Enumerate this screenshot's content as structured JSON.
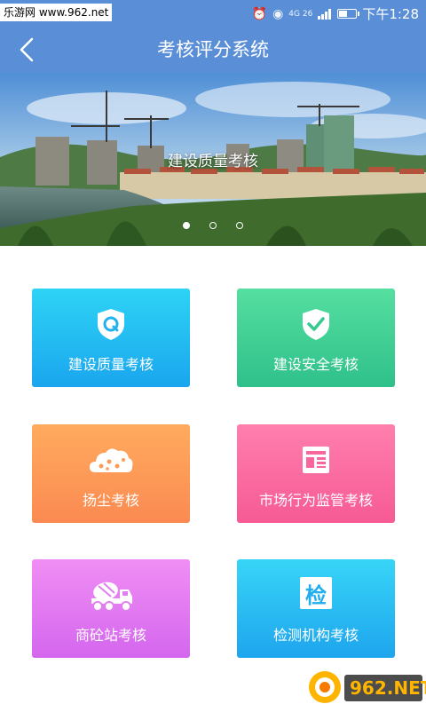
{
  "status_bar": {
    "watermark": "乐游网 www.962.net",
    "network": "4G 26",
    "battery_level": 0.5,
    "time": "下午1:28"
  },
  "nav": {
    "title": "考核评分系统",
    "back_icon": "chevron-left-icon"
  },
  "banner": {
    "caption": "建设质量考核",
    "slide_count": 3,
    "active_slide": 1
  },
  "tiles": [
    {
      "label": "建设质量考核",
      "icon": "shield-q-icon",
      "colors": [
        "#2ed3f5",
        "#1aa6ee"
      ]
    },
    {
      "label": "建设安全考核",
      "icon": "shield-check-icon",
      "colors": [
        "#55dfa0",
        "#2fc08a"
      ]
    },
    {
      "label": "扬尘考核",
      "icon": "dust-cloud-icon",
      "colors": [
        "#ffab5e",
        "#fb8a52"
      ]
    },
    {
      "label": "市场行为监管考核",
      "icon": "newspaper-icon",
      "colors": [
        "#ff7fad",
        "#f65a95"
      ]
    },
    {
      "label": "商砼站考核",
      "icon": "mixer-truck-icon",
      "colors": [
        "#f08ef4",
        "#d466ee"
      ]
    },
    {
      "label": "检测机构考核",
      "icon": "inspect-char-icon",
      "icon_text": "检",
      "colors": [
        "#38d5f7",
        "#1ea5ee"
      ]
    }
  ],
  "colors": {
    "primary": "#5a8fd8"
  }
}
